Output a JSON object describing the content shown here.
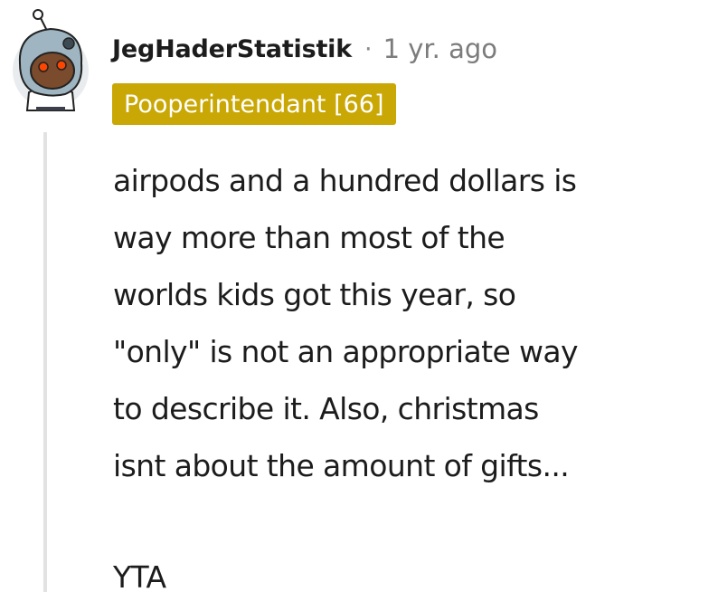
{
  "comment": {
    "author": "JegHaderStatistik",
    "separator": "·",
    "timestamp": "1 yr. ago",
    "flair": "Pooperintendant [66]",
    "body_lines": [
      "airpods and a hundred dollars is",
      "way more than most of the",
      "worlds kids got this year, so",
      "\"only\" is not an appropriate way",
      "to describe it. Also, christmas",
      "isnt about the amount of gifts..."
    ],
    "verdict": "YTA"
  },
  "colors": {
    "flair_background": "#c9a704",
    "flair_text": "#ffffff",
    "username": "#1c1c1c",
    "timestamp": "#7c7c7c",
    "thread_line": "#e2e2e2"
  },
  "icons": {
    "avatar": "snoo-avatar-icon"
  }
}
